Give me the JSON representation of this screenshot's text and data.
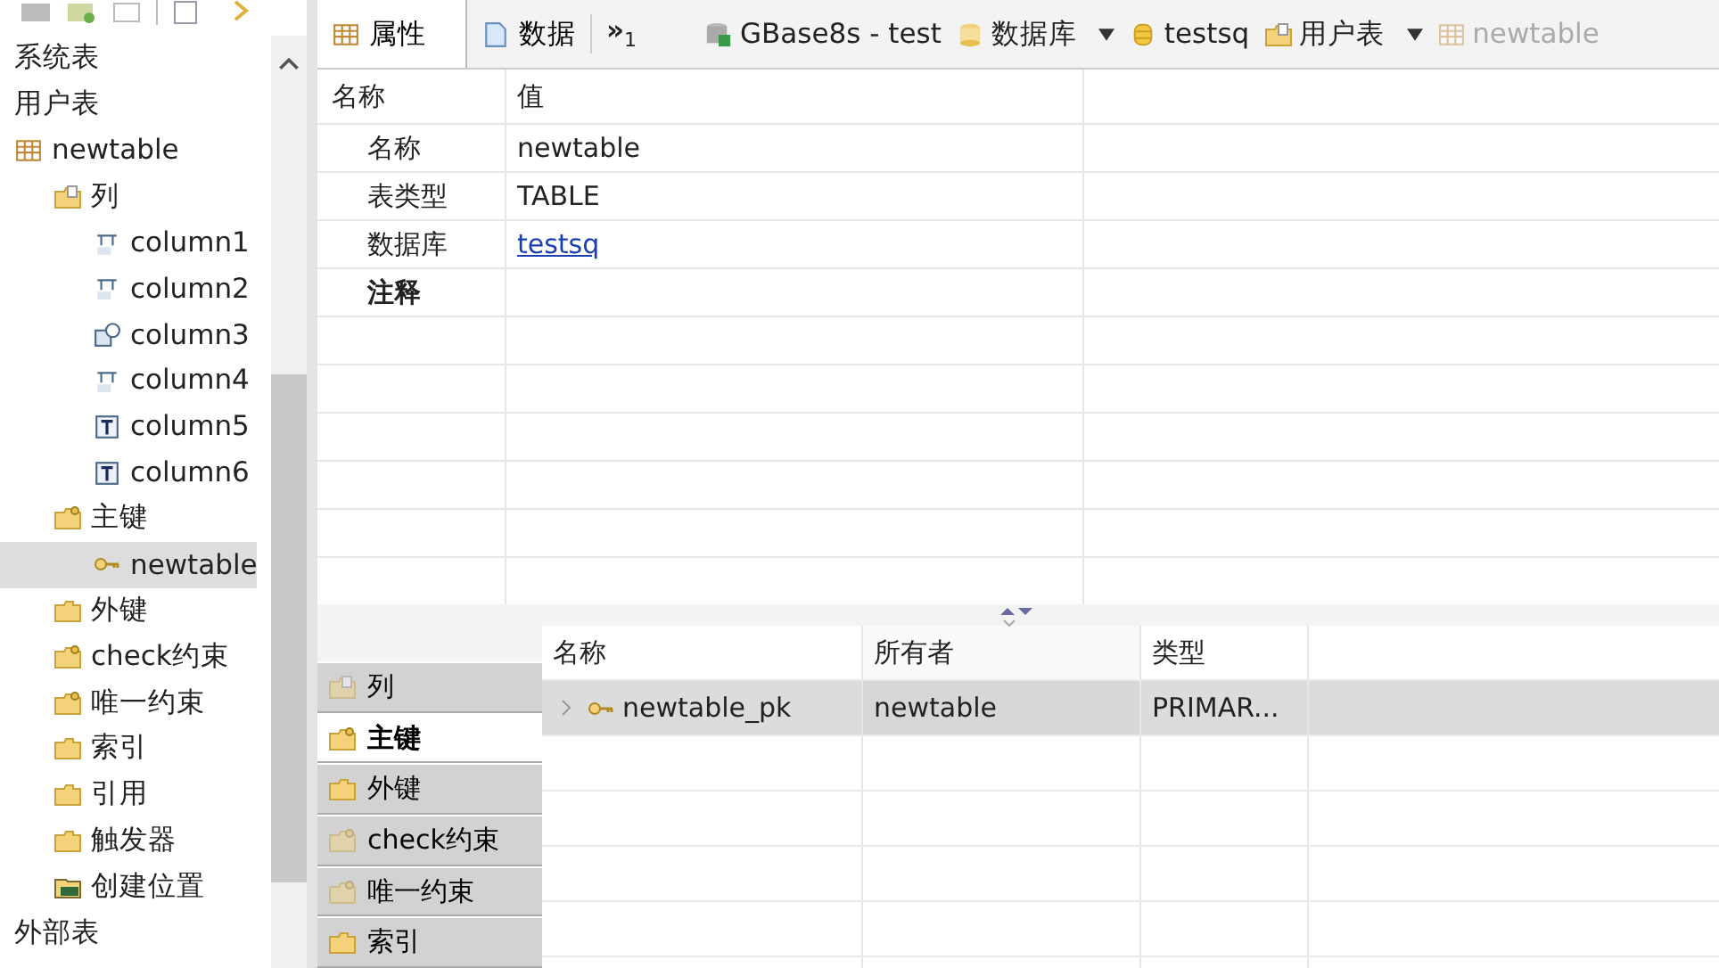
{
  "tree": [
    {
      "label": "系统表",
      "selected": false
    },
    {
      "label": "用户表",
      "selected": false,
      "children": [
        {
          "label": "newtable",
          "kind": "table",
          "selected": false,
          "children": [
            {
              "label": "列",
              "kind": "folder-doc",
              "selected": false,
              "children": [
                {
                  "label": "column1",
                  "kind": "col-num",
                  "selected": false
                },
                {
                  "label": "column2",
                  "kind": "col-num",
                  "selected": false
                },
                {
                  "label": "column3",
                  "kind": "col-date",
                  "selected": false
                },
                {
                  "label": "column4",
                  "kind": "col-num",
                  "selected": false
                },
                {
                  "label": "column5",
                  "kind": "col-text",
                  "selected": false
                },
                {
                  "label": "column6",
                  "kind": "col-text",
                  "selected": false
                }
              ]
            },
            {
              "label": "主键",
              "kind": "folder-key",
              "selected": false,
              "children": [
                {
                  "label": "newtable",
                  "kind": "key",
                  "selected": true
                }
              ]
            },
            {
              "label": "外键",
              "kind": "folder",
              "selected": false
            },
            {
              "label": "check约束",
              "kind": "folder-key",
              "selected": false
            },
            {
              "label": "唯一约束",
              "kind": "folder-key",
              "selected": false
            },
            {
              "label": "索引",
              "kind": "folder",
              "selected": false
            },
            {
              "label": "引用",
              "kind": "folder",
              "selected": false
            },
            {
              "label": "触发器",
              "kind": "folder",
              "selected": false
            },
            {
              "label": "创建位置",
              "kind": "db-folder",
              "selected": false
            }
          ]
        }
      ]
    },
    {
      "label": "外部表",
      "selected": false
    }
  ],
  "editor_tabs": [
    {
      "label": "属性",
      "kind": "table",
      "selected": true
    },
    {
      "label": "数据",
      "kind": "doc",
      "selected": false
    }
  ],
  "overflow": {
    "mark": "»",
    "count": "1"
  },
  "breadcrumb": [
    {
      "label": "GBase8s - test",
      "kind": "server",
      "dropdown": false
    },
    {
      "label": "数据库",
      "kind": "dbs",
      "dropdown": true
    },
    {
      "label": "testsq",
      "kind": "db",
      "dropdown": false
    },
    {
      "label": "用户表",
      "kind": "folder-doc",
      "dropdown": true
    },
    {
      "label": "newtable",
      "kind": "table",
      "dropdown": false
    }
  ],
  "properties": {
    "columns": [
      "名称",
      "值"
    ],
    "rows": [
      {
        "name": "名称",
        "value": "newtable",
        "kind": "text"
      },
      {
        "name": "表类型",
        "value": "TABLE",
        "kind": "text"
      },
      {
        "name": "数据库",
        "value": "testsq",
        "kind": "link"
      },
      {
        "name": "注释",
        "kind": "category"
      }
    ]
  },
  "side_tabs": [
    {
      "label": "列",
      "kind": "folder-doc",
      "selected": false
    },
    {
      "label": "主键",
      "kind": "folder-key",
      "selected": true
    },
    {
      "label": "外键",
      "kind": "folder",
      "selected": false
    },
    {
      "label": "check约束",
      "kind": "folder-key",
      "selected": false
    },
    {
      "label": "唯一约束",
      "kind": "folder-key",
      "selected": false
    },
    {
      "label": "索引",
      "kind": "folder",
      "selected": false
    }
  ],
  "constraints": {
    "columns": [
      "名称",
      "所有者",
      "类型"
    ],
    "rows": [
      {
        "cells": [
          "newtable_pk",
          "newtable",
          "PRIMAR..."
        ],
        "selected": true
      }
    ]
  }
}
